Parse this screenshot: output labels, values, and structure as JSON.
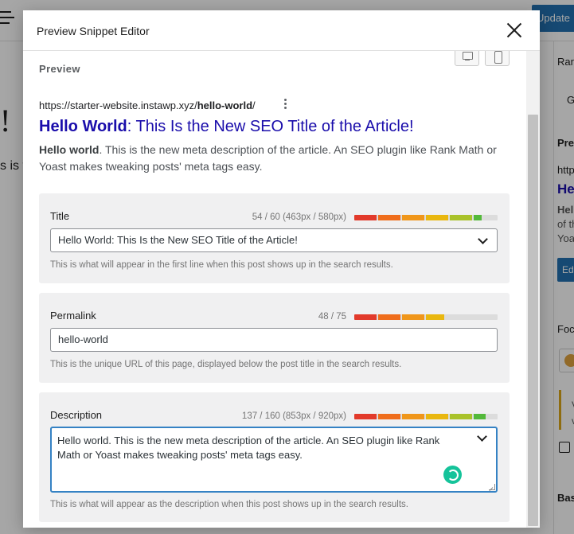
{
  "background": {
    "update_label": "Update",
    "heading_fragment": "!",
    "text_fragment": "s is y",
    "sidebar": {
      "tab_label": "Ran",
      "tab2_label": "G",
      "preview_label": "Pre",
      "url_fragment": "http",
      "title_fragment": "He",
      "desc_line1": "Hel",
      "desc_line2": "of th",
      "desc_line3": "Yoa",
      "edit_label": "Ed",
      "focus_label": "Foc",
      "warn_line1": "V",
      "warn_line2": "v",
      "basic_label": "Bas"
    }
  },
  "modal": {
    "title": "Preview Snippet Editor",
    "preview_label": "Preview",
    "serp": {
      "url_base": "https://starter-website.instawp.xyz/",
      "url_slug": "hello-world",
      "url_trailing": "/",
      "title_bold": "Hello World",
      "title_rest": ": This Is the New SEO Title of the Article!",
      "desc_bold": "Hello world",
      "desc_rest": ". This is the new meta description of the article. An SEO plugin like Rank Math or Yoast makes tweaking posts' meta tags easy."
    },
    "fields": {
      "title": {
        "label": "Title",
        "counter": "54 / 60 (463px / 580px)",
        "value": "Hello World: This Is the New SEO Title of the Article!",
        "help": "This is what will appear in the first line when this post shows up in the search results.",
        "progress": 0.9
      },
      "permalink": {
        "label": "Permalink",
        "counter": "48 / 75",
        "value": "hello-world",
        "help": "This is the unique URL of this page, displayed below the post title in the search results.",
        "progress": 0.64
      },
      "description": {
        "label": "Description",
        "counter": "137 / 160 (853px / 920px)",
        "value": "Hello world. This is the new meta description of the article. An SEO plugin like Rank Math or Yoast makes tweaking posts' meta tags easy.",
        "help": "This is what will appear as the description when this post shows up in the search results.",
        "progress": 0.93
      }
    },
    "meter_colors": [
      "#e23a2b",
      "#ef6d1c",
      "#f0961a",
      "#e9b70f",
      "#a9c22a",
      "#53b93a"
    ]
  }
}
